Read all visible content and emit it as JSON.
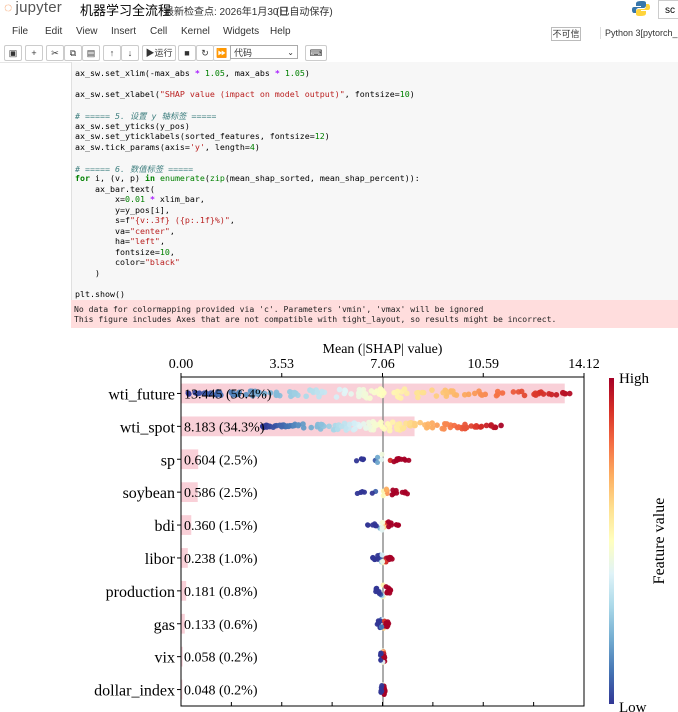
{
  "header": {
    "logo_text": "jupyter",
    "notebook_title": "机器学习全流程",
    "checkpoint": "最新检查点: 2026年1月30日",
    "autosave": "(已自动保存)",
    "login_stub": "sc"
  },
  "menu": {
    "items": [
      "File",
      "Edit",
      "View",
      "Insert",
      "Cell",
      "Kernel",
      "Widgets",
      "Help"
    ],
    "trusted": "不可信",
    "kernel": "Python 3[pytorch_"
  },
  "toolbar": {
    "run_label": "运行",
    "cell_type": "代码"
  },
  "code": {
    "lines": [
      "ax_sw.set_xlim(-max_abs * 1.05, max_abs * 1.05)",
      "",
      "ax_sw.set_xlabel(\"SHAP value (impact on model output)\", fontsize=10)",
      "",
      "# ===== 5. 设置 y 轴标签 =====",
      "ax_sw.set_yticks(y_pos)",
      "ax_sw.set_yticklabels(sorted_features, fontsize=12)",
      "ax_sw.tick_params(axis='y', length=4)",
      "",
      "# ===== 6. 数值标签 =====",
      "for i, (v, p) in enumerate(zip(mean_shap_sorted, mean_shap_percent)):",
      "    ax_bar.text(",
      "        x=0.01 * xlim_bar,",
      "        y=y_pos[i],",
      "        s=f\"{v:.3f} ({p:.1f}%)\",",
      "        va=\"center\",",
      "        ha=\"left\",",
      "        fontsize=10,",
      "        color=\"black\"",
      "    )",
      "",
      "plt.show()"
    ]
  },
  "stderr": {
    "lines": [
      "No data for colormapping provided via 'c'. Parameters 'vmin', 'vmax' will be ignored",
      "This figure includes Axes that are not compatible with tight_layout, so results might be incorrect."
    ]
  },
  "chart_data": {
    "type": "bar",
    "xlabel": "Mean (|SHAP| value)",
    "xticks": [
      "0.00",
      "3.53",
      "7.06",
      "10.59",
      "14.12"
    ],
    "xlim": [
      0,
      14.12
    ],
    "colorbar": {
      "label": "Feature value",
      "high": "High",
      "low": "Low"
    },
    "categories": [
      "wti_future",
      "wti_spot",
      "sp",
      "soybean",
      "bdi",
      "libor",
      "production",
      "gas",
      "vix",
      "dollar_index"
    ],
    "values": [
      13.445,
      8.183,
      0.604,
      0.586,
      0.36,
      0.238,
      0.181,
      0.133,
      0.058,
      0.048
    ],
    "percent": [
      56.4,
      34.3,
      2.5,
      2.5,
      1.5,
      1.0,
      0.8,
      0.6,
      0.2,
      0.2
    ],
    "value_labels": [
      "13.445 (56.4%)",
      "8.183 (34.3%)",
      "0.604 (2.5%)",
      "0.586 (2.5%)",
      "0.360 (1.5%)",
      "0.238 (1.0%)",
      "0.181 (0.8%)",
      "0.133 (0.6%)",
      "0.058 (0.2%)",
      "0.048 (0.2%)"
    ],
    "bar_color": "#f9d0d8",
    "colormap": [
      "#313695",
      "#4575b4",
      "#74add1",
      "#abd9e9",
      "#e0f3f8",
      "#ffffbf",
      "#fee090",
      "#fdae61",
      "#f46d43",
      "#d73027",
      "#a50026"
    ]
  }
}
